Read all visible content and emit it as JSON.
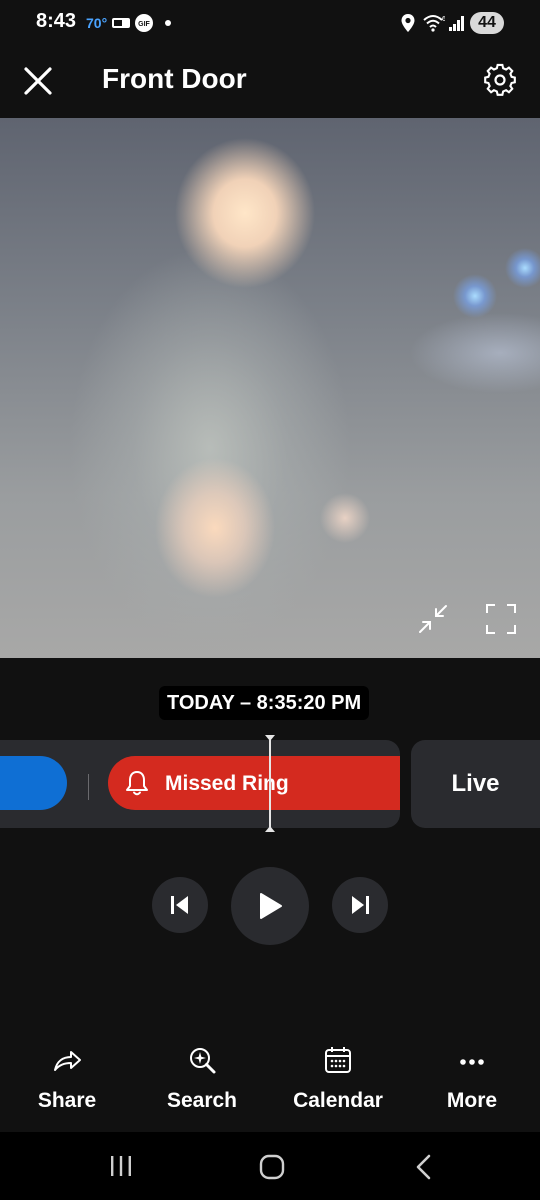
{
  "status_bar": {
    "time": "8:43",
    "temperature": "70°",
    "battery": "44",
    "icons": [
      "mlb-icon",
      "gif-icon",
      "dot-icon",
      "location-icon",
      "wifi-6-icon",
      "signal-icon",
      "battery-icon"
    ]
  },
  "header": {
    "title": "Front Door",
    "close_icon": "close-icon",
    "settings_icon": "gear-icon"
  },
  "video": {
    "minimize_icon": "minimize-icon",
    "fullscreen_icon": "fullscreen-icon"
  },
  "timeline": {
    "timestamp": "TODAY – 8:35:20 PM",
    "event_label": "Missed Ring",
    "event_icon": "bell-icon",
    "live_label": "Live",
    "colors": {
      "event": "#d42a1f",
      "motion": "#0f6fd4",
      "track": "#2a2b2f"
    }
  },
  "playback": {
    "previous_icon": "skip-previous-icon",
    "play_icon": "play-icon",
    "next_icon": "skip-next-icon"
  },
  "actions": [
    {
      "label": "Share",
      "icon": "share-icon"
    },
    {
      "label": "Search",
      "icon": "search-sparkle-icon"
    },
    {
      "label": "Calendar",
      "icon": "calendar-icon"
    },
    {
      "label": "More",
      "icon": "more-icon"
    }
  ],
  "nav_bar": {
    "icons": [
      "recents-icon",
      "home-icon",
      "back-icon"
    ]
  }
}
